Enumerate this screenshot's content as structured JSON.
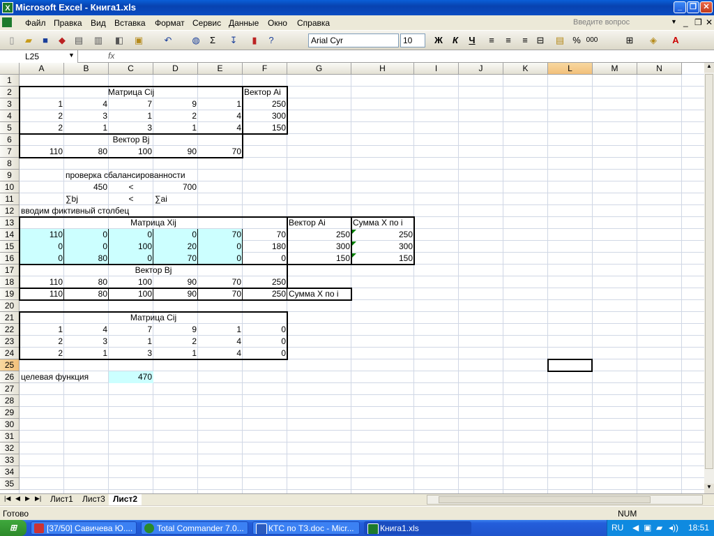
{
  "window": {
    "title": "Microsoft Excel - Книга1.xls",
    "app_icon": "excel-icon"
  },
  "menu": {
    "items": [
      "Файл",
      "Правка",
      "Вид",
      "Вставка",
      "Формат",
      "Сервис",
      "Данные",
      "Окно",
      "Справка"
    ],
    "ask_placeholder": "Введите вопрос"
  },
  "toolbar": {
    "font": "Arial Cyr",
    "size": "10",
    "bold": "Ж",
    "italic": "К",
    "underline": "Ч",
    "percent": "%",
    "thousands": "000",
    "sigma": "Σ"
  },
  "formula_bar": {
    "cell_ref": "L25",
    "fx": "fx",
    "value": ""
  },
  "columns": [
    "A",
    "B",
    "C",
    "D",
    "E",
    "F",
    "G",
    "H",
    "I",
    "J",
    "K",
    "L",
    "M",
    "N"
  ],
  "rows": [
    "1",
    "2",
    "3",
    "4",
    "5",
    "6",
    "7",
    "8",
    "9",
    "10",
    "11",
    "12",
    "13",
    "14",
    "15",
    "16",
    "17",
    "18",
    "19",
    "20",
    "21",
    "22",
    "23",
    "24",
    "25",
    "26",
    "27",
    "28",
    "29",
    "30",
    "31",
    "32",
    "33",
    "34",
    "35"
  ],
  "cells": {
    "matrix_cij_title": "Матрица Cij",
    "vector_ai_title": "Вектор Ai",
    "cij": [
      [
        "1",
        "4",
        "7",
        "9",
        "1"
      ],
      [
        "2",
        "3",
        "1",
        "2",
        "4"
      ],
      [
        "2",
        "1",
        "3",
        "1",
        "4"
      ]
    ],
    "ai": [
      "250",
      "300",
      "150"
    ],
    "vector_bj_title": "Вектор Bj",
    "bj": [
      "110",
      "80",
      "100",
      "90",
      "70"
    ],
    "balance_check": "проверка сбалансированности",
    "sum_bj_value": "450",
    "lt1": "<",
    "sum_ai_value": "700",
    "sum_bj_label": "∑bj",
    "lt2": "<",
    "sum_ai_label": "∑ai",
    "fictive_column": "вводим фиктивный столбец",
    "matrix_xij_title": "Матрица Xij",
    "vector_ai_title2": "Вектор Ai",
    "sum_x_by_i_title": "Сумма X по i",
    "xij": [
      [
        "110",
        "0",
        "0",
        "0",
        "70",
        "70"
      ],
      [
        "0",
        "0",
        "100",
        "20",
        "0",
        "180"
      ],
      [
        "0",
        "80",
        "0",
        "70",
        "0",
        "0"
      ]
    ],
    "ai2": [
      "250",
      "300",
      "150"
    ],
    "sum_x_i": [
      "250",
      "300",
      "150"
    ],
    "vector_bj_title2": "Вектор Bj",
    "bj2": [
      "110",
      "80",
      "100",
      "90",
      "70",
      "250"
    ],
    "sum_x_j": [
      "110",
      "80",
      "100",
      "90",
      "70",
      "250"
    ],
    "sum_x_by_j_label": "Сумма X по  i",
    "matrix_cij_title2": "Матрица Cij",
    "cij2": [
      [
        "1",
        "4",
        "7",
        "9",
        "1",
        "0"
      ],
      [
        "2",
        "3",
        "1",
        "2",
        "4",
        "0"
      ],
      [
        "2",
        "1",
        "3",
        "1",
        "4",
        "0"
      ]
    ],
    "objective_label": "целевая функция",
    "objective_value": "470"
  },
  "sheet_tabs": [
    "Лист1",
    "Лист3",
    "Лист2"
  ],
  "active_sheet": "Лист2",
  "status": {
    "ready": "Готово",
    "num": "NUM"
  },
  "taskbar": {
    "start": "пуск",
    "tasks": [
      "[37/50] Савичева Ю....",
      "Total Commander 7.0...",
      "КТС по ТЗ.doc - Micr...",
      "Книга1.xls"
    ],
    "lang": "RU",
    "clock": "18:51"
  },
  "colors": {
    "highlight": "#ccffff",
    "title_bar": "#0a4cc2",
    "grid_line": "#d0d7e5"
  }
}
